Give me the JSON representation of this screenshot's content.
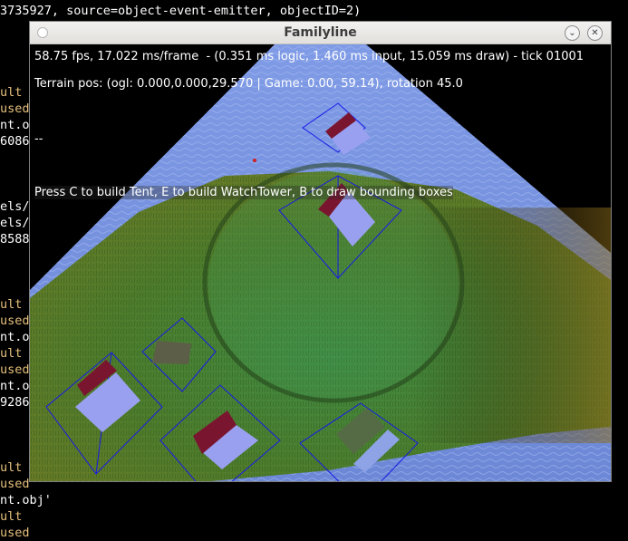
{
  "terminal": {
    "lines": [
      {
        "text": "3735927, source=object-event-emitter, objectID=2)",
        "color": "white"
      },
      {
        "text": "ult",
        "color": "yellow"
      },
      {
        "text": "used",
        "color": "yellow"
      },
      {
        "text": "nt.o",
        "color": "white"
      },
      {
        "text": "6086",
        "color": "white"
      },
      {
        "text": "els/",
        "color": "white"
      },
      {
        "text": "els/",
        "color": "white"
      },
      {
        "text": "8588",
        "color": "white"
      },
      {
        "text": "ult",
        "color": "yellow"
      },
      {
        "text": "used",
        "color": "yellow"
      },
      {
        "text": "nt.o",
        "color": "white"
      },
      {
        "text": "ult",
        "color": "yellow"
      },
      {
        "text": "used",
        "color": "yellow"
      },
      {
        "text": "nt.o",
        "color": "white"
      },
      {
        "text": "9286",
        "color": "white"
      },
      {
        "text": "ult",
        "color": "yellow"
      },
      {
        "text": "used",
        "color": "yellow"
      },
      {
        "text": "nt.obj'",
        "color": "white"
      },
      {
        "text": "ult",
        "color": "yellow"
      },
      {
        "text": "used",
        "color": "yellow"
      }
    ],
    "colors": {
      "white": "#ffffff",
      "yellow": "#e5c07b"
    }
  },
  "window": {
    "title": "Familyline",
    "minimize_icon": "chevron-down-icon",
    "close_icon": "close-icon"
  },
  "hud": {
    "fps_line": "58.75 fps, 17.022 ms/frame  - (0.351 ms logic, 1.460 ms input, 15.059 ms draw) - tick 01001",
    "terrain_line": "Terrain pos: (ogl: 0.000,0.000,29.570 | Game: 0.00, 59.14), rotation 45.0",
    "separator": "--",
    "hint_line": "Press C to build Tent, E to build WatchTower, B to draw bounding boxes"
  },
  "colors": {
    "sky_water": "#7d97e3",
    "grass": "#4f7f2e",
    "bounding_box": "#1818e8",
    "tent_roof": "#9aa0f0",
    "tent_side": "#7a1530"
  }
}
